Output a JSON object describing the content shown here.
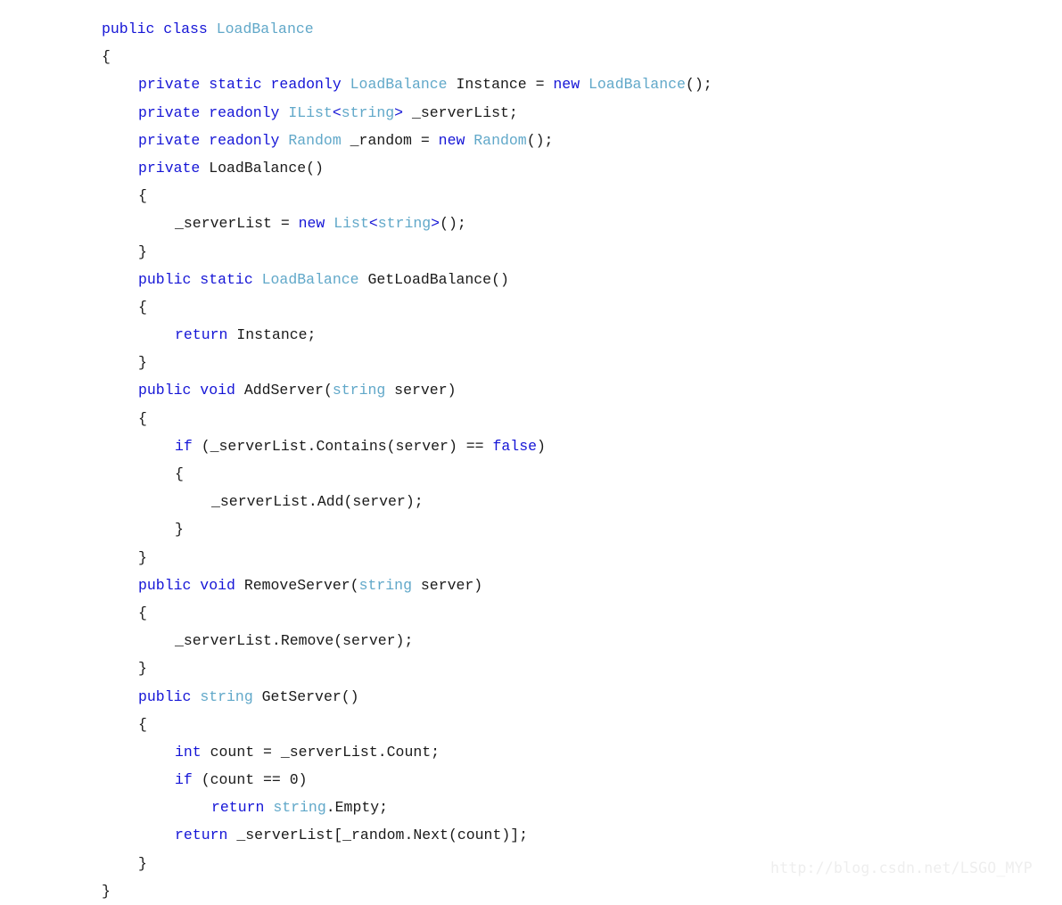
{
  "editor": {
    "language": "csharp",
    "background_color": "#ffffff",
    "colors": {
      "keyword": "#1515d6",
      "type": "#61a8c9",
      "plain": "#1a1a1a",
      "watermark": "#eeeeee"
    },
    "lines": [
      {
        "indent": 0,
        "tokens": [
          {
            "t": "public class ",
            "c": "kw"
          },
          {
            "t": "LoadBalance",
            "c": "type"
          }
        ]
      },
      {
        "indent": 0,
        "tokens": [
          {
            "t": "{",
            "c": "pl"
          }
        ]
      },
      {
        "indent": 1,
        "tokens": [
          {
            "t": "private static readonly ",
            "c": "kw"
          },
          {
            "t": "LoadBalance",
            "c": "type"
          },
          {
            "t": " Instance = ",
            "c": "pl"
          },
          {
            "t": "new ",
            "c": "kw"
          },
          {
            "t": "LoadBalance",
            "c": "type"
          },
          {
            "t": "();",
            "c": "pl"
          }
        ]
      },
      {
        "indent": 1,
        "tokens": [
          {
            "t": "private readonly ",
            "c": "kw"
          },
          {
            "t": "IList",
            "c": "type"
          },
          {
            "t": "<",
            "c": "kw"
          },
          {
            "t": "string",
            "c": "type"
          },
          {
            "t": ">",
            "c": "kw"
          },
          {
            "t": " _serverList;",
            "c": "pl"
          }
        ]
      },
      {
        "indent": 1,
        "tokens": [
          {
            "t": "private readonly ",
            "c": "kw"
          },
          {
            "t": "Random",
            "c": "type"
          },
          {
            "t": " _random = ",
            "c": "pl"
          },
          {
            "t": "new ",
            "c": "kw"
          },
          {
            "t": "Random",
            "c": "type"
          },
          {
            "t": "();",
            "c": "pl"
          }
        ]
      },
      {
        "indent": 1,
        "tokens": [
          {
            "t": "private ",
            "c": "kw"
          },
          {
            "t": "LoadBalance()",
            "c": "pl"
          }
        ]
      },
      {
        "indent": 1,
        "tokens": [
          {
            "t": "{",
            "c": "pl"
          }
        ]
      },
      {
        "indent": 2,
        "tokens": [
          {
            "t": "_serverList = ",
            "c": "pl"
          },
          {
            "t": "new ",
            "c": "kw"
          },
          {
            "t": "List",
            "c": "type"
          },
          {
            "t": "<",
            "c": "kw"
          },
          {
            "t": "string",
            "c": "type"
          },
          {
            "t": ">",
            "c": "kw"
          },
          {
            "t": "();",
            "c": "pl"
          }
        ]
      },
      {
        "indent": 1,
        "tokens": [
          {
            "t": "}",
            "c": "pl"
          }
        ]
      },
      {
        "indent": 1,
        "tokens": [
          {
            "t": "public static ",
            "c": "kw"
          },
          {
            "t": "LoadBalance",
            "c": "type"
          },
          {
            "t": " GetLoadBalance()",
            "c": "pl"
          }
        ]
      },
      {
        "indent": 1,
        "tokens": [
          {
            "t": "{",
            "c": "pl"
          }
        ]
      },
      {
        "indent": 2,
        "tokens": [
          {
            "t": "return ",
            "c": "kw"
          },
          {
            "t": "Instance;",
            "c": "pl"
          }
        ]
      },
      {
        "indent": 1,
        "tokens": [
          {
            "t": "}",
            "c": "pl"
          }
        ]
      },
      {
        "indent": 1,
        "tokens": [
          {
            "t": "public void ",
            "c": "kw"
          },
          {
            "t": "AddServer(",
            "c": "pl"
          },
          {
            "t": "string",
            "c": "type"
          },
          {
            "t": " server)",
            "c": "pl"
          }
        ]
      },
      {
        "indent": 1,
        "tokens": [
          {
            "t": "{",
            "c": "pl"
          }
        ]
      },
      {
        "indent": 2,
        "tokens": [
          {
            "t": "if ",
            "c": "kw"
          },
          {
            "t": "(_serverList.Contains(server) == ",
            "c": "pl"
          },
          {
            "t": "false",
            "c": "kw"
          },
          {
            "t": ")",
            "c": "pl"
          }
        ]
      },
      {
        "indent": 2,
        "tokens": [
          {
            "t": "{",
            "c": "pl"
          }
        ]
      },
      {
        "indent": 3,
        "tokens": [
          {
            "t": "_serverList.Add(server);",
            "c": "pl"
          }
        ]
      },
      {
        "indent": 2,
        "tokens": [
          {
            "t": "}",
            "c": "pl"
          }
        ]
      },
      {
        "indent": 1,
        "tokens": [
          {
            "t": "}",
            "c": "pl"
          }
        ]
      },
      {
        "indent": 1,
        "tokens": [
          {
            "t": "public void ",
            "c": "kw"
          },
          {
            "t": "RemoveServer(",
            "c": "pl"
          },
          {
            "t": "string",
            "c": "type"
          },
          {
            "t": " server)",
            "c": "pl"
          }
        ]
      },
      {
        "indent": 1,
        "tokens": [
          {
            "t": "{",
            "c": "pl"
          }
        ]
      },
      {
        "indent": 2,
        "tokens": [
          {
            "t": "_serverList.Remove(server);",
            "c": "pl"
          }
        ]
      },
      {
        "indent": 1,
        "tokens": [
          {
            "t": "}",
            "c": "pl"
          }
        ]
      },
      {
        "indent": 1,
        "tokens": [
          {
            "t": "public ",
            "c": "kw"
          },
          {
            "t": "string",
            "c": "type"
          },
          {
            "t": " GetServer()",
            "c": "pl"
          }
        ]
      },
      {
        "indent": 1,
        "tokens": [
          {
            "t": "{",
            "c": "pl"
          }
        ]
      },
      {
        "indent": 2,
        "tokens": [
          {
            "t": "int ",
            "c": "kw"
          },
          {
            "t": "count = _serverList.Count;",
            "c": "pl"
          }
        ]
      },
      {
        "indent": 2,
        "tokens": [
          {
            "t": "if ",
            "c": "kw"
          },
          {
            "t": "(count == 0)",
            "c": "pl"
          }
        ]
      },
      {
        "indent": 3,
        "tokens": [
          {
            "t": "return ",
            "c": "kw"
          },
          {
            "t": "string",
            "c": "type"
          },
          {
            "t": ".Empty;",
            "c": "pl"
          }
        ]
      },
      {
        "indent": 2,
        "tokens": [
          {
            "t": "return ",
            "c": "kw"
          },
          {
            "t": "_serverList[_random.Next(count)];",
            "c": "pl"
          }
        ]
      },
      {
        "indent": 1,
        "tokens": [
          {
            "t": "}",
            "c": "pl"
          }
        ]
      },
      {
        "indent": 0,
        "tokens": [
          {
            "t": "}",
            "c": "pl"
          }
        ]
      }
    ]
  },
  "watermark": {
    "text": "http://blog.csdn.net/LSGO_MYP"
  }
}
